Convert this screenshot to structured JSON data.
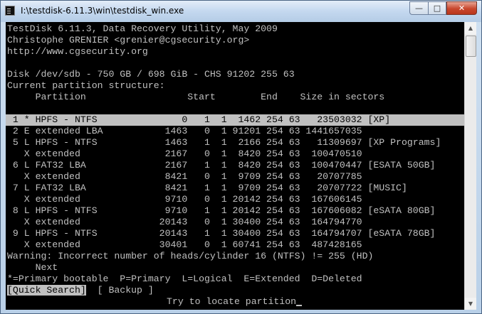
{
  "window": {
    "title": "I:\\testdisk-6.11.3\\win\\testdisk_win.exe",
    "minimize_glyph": "—",
    "maximize_glyph": "□",
    "close_glyph": "✕",
    "icon": "console-icon"
  },
  "console": {
    "header": [
      "TestDisk 6.11.3, Data Recovery Utility, May 2009",
      "Christophe GRENIER <grenier@cgsecurity.org>",
      "http://www.cgsecurity.org"
    ],
    "disk_line": "Disk /dev/sdb - 750 GB / 698 GiB - CHS 91202 255 63",
    "structure_label": "Current partition structure:",
    "columns_line": "     Partition                  Start        End    Size in sectors",
    "rows": [
      " 1 * HPFS - NTFS               0   1  1  1462 254 63   23503032 [XP]",
      " 2 E extended LBA           1463   0  1 91201 254 63 1441657035",
      " 5 L HPFS - NTFS            1463   1  1  2166 254 63   11309697 [XP Programs]",
      "   X extended               2167   0  1  8420 254 63  100470510",
      " 6 L FAT32 LBA              2167   1  1  8420 254 63  100470447 [ESATA 50GB]",
      "   X extended               8421   0  1  9709 254 63   20707785",
      " 7 L FAT32 LBA              8421   1  1  9709 254 63   20707722 [MUSIC]",
      "   X extended               9710   0  1 20142 254 63  167606145",
      " 8 L HPFS - NTFS            9710   1  1 20142 254 63  167606082 [eSATA 80GB]",
      "   X extended              20143   0  1 30400 254 63  164794770",
      " 9 L HPFS - NTFS           20143   1  1 30400 254 63  164794707 [eSATA 78GB]",
      "   X extended              30401   0  1 60741 254 63  487428165"
    ],
    "warning": "Warning: Incorrect number of heads/cylinder 16 (NTFS) != 255 (HD)",
    "next_label": "     Next",
    "legend": "*=Primary bootable  P=Primary  L=Logical  E=Extended  D=Deleted",
    "menu": {
      "quick_search": "[Quick Search]",
      "backup": "[ Backup ]"
    },
    "hint": "Try to locate partition"
  }
}
